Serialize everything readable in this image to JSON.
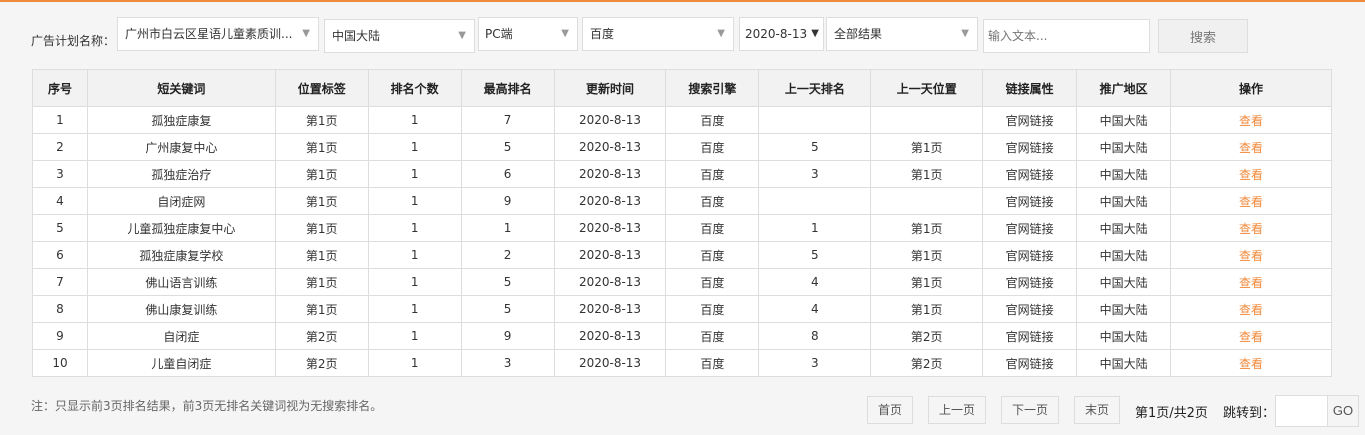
{
  "filters": {
    "plan_label": "广告计划名称：",
    "plan": "广州市白云区星语儿童素质训...",
    "region": "中国大陆",
    "device": "PC端",
    "engine": "百度",
    "date": "2020-8-13",
    "result": "全部结果",
    "search_placeholder": "输入文本...",
    "search_button": "搜索"
  },
  "table": {
    "headers": [
      "序号",
      "短关键词",
      "位置标签",
      "排名个数",
      "最高排名",
      "更新时间",
      "搜索引擎",
      "上一天排名",
      "上一天位置",
      "链接属性",
      "推广地区",
      "操作"
    ],
    "rows": [
      [
        "1",
        "孤独症康复",
        "第1页",
        "1",
        "7",
        "2020-8-13",
        "百度",
        "",
        "",
        "官网链接",
        "中国大陆",
        "查看"
      ],
      [
        "2",
        "广州康复中心",
        "第1页",
        "1",
        "5",
        "2020-8-13",
        "百度",
        "5",
        "第1页",
        "官网链接",
        "中国大陆",
        "查看"
      ],
      [
        "3",
        "孤独症治疗",
        "第1页",
        "1",
        "6",
        "2020-8-13",
        "百度",
        "3",
        "第1页",
        "官网链接",
        "中国大陆",
        "查看"
      ],
      [
        "4",
        "自闭症网",
        "第1页",
        "1",
        "9",
        "2020-8-13",
        "百度",
        "",
        "",
        "官网链接",
        "中国大陆",
        "查看"
      ],
      [
        "5",
        "儿童孤独症康复中心",
        "第1页",
        "1",
        "1",
        "2020-8-13",
        "百度",
        "1",
        "第1页",
        "官网链接",
        "中国大陆",
        "查看"
      ],
      [
        "6",
        "孤独症康复学校",
        "第1页",
        "1",
        "2",
        "2020-8-13",
        "百度",
        "5",
        "第1页",
        "官网链接",
        "中国大陆",
        "查看"
      ],
      [
        "7",
        "佛山语言训练",
        "第1页",
        "1",
        "5",
        "2020-8-13",
        "百度",
        "4",
        "第1页",
        "官网链接",
        "中国大陆",
        "查看"
      ],
      [
        "8",
        "佛山康复训练",
        "第1页",
        "1",
        "5",
        "2020-8-13",
        "百度",
        "4",
        "第1页",
        "官网链接",
        "中国大陆",
        "查看"
      ],
      [
        "9",
        "自闭症",
        "第2页",
        "1",
        "9",
        "2020-8-13",
        "百度",
        "8",
        "第2页",
        "官网链接",
        "中国大陆",
        "查看"
      ],
      [
        "10",
        "儿童自闭症",
        "第2页",
        "1",
        "3",
        "2020-8-13",
        "百度",
        "3",
        "第2页",
        "官网链接",
        "中国大陆",
        "查看"
      ]
    ]
  },
  "footer": {
    "note": "注：只显示前3页排名结果，前3页无排名关键词视为无搜索排名。",
    "first": "首页",
    "prev": "上一页",
    "next": "下一页",
    "last": "末页",
    "page_info": "第1页/共2页",
    "jump_label": "跳转到：",
    "jump_value": "",
    "go": "GO"
  },
  "colors": {
    "accent": "#f08a3c"
  }
}
